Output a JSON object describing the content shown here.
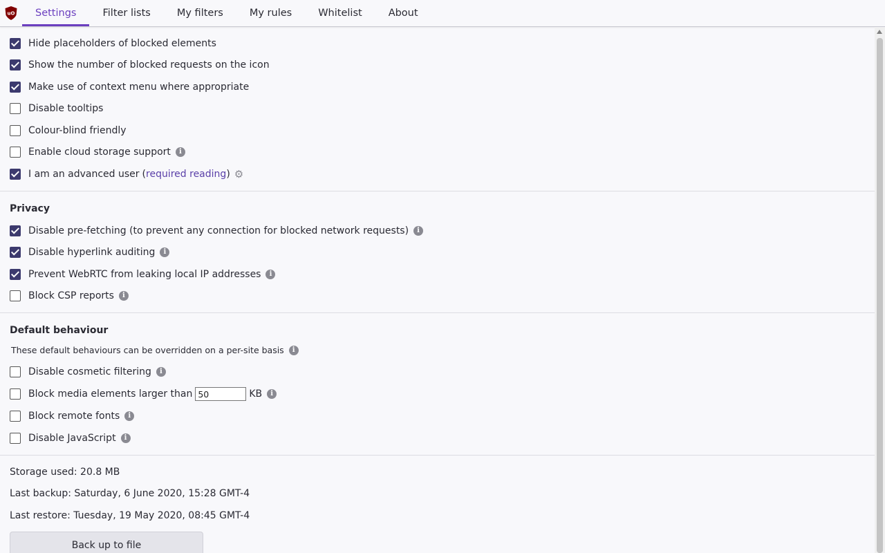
{
  "tabs": [
    "Settings",
    "Filter lists",
    "My filters",
    "My rules",
    "Whitelist",
    "About"
  ],
  "appearance": {
    "options": [
      {
        "label": "Hide placeholders of blocked elements",
        "checked": true
      },
      {
        "label": "Show the number of blocked requests on the icon",
        "checked": true
      },
      {
        "label": "Make use of context menu where appropriate",
        "checked": true
      },
      {
        "label": "Disable tooltips",
        "checked": false
      },
      {
        "label": "Colour-blind friendly",
        "checked": false
      },
      {
        "label": "Enable cloud storage support",
        "checked": false
      },
      {
        "label": "I am an advanced user",
        "checked": true
      }
    ],
    "advanced_paren_open": "(",
    "advanced_link": "required reading",
    "advanced_paren_close": ")"
  },
  "privacy": {
    "heading": "Privacy",
    "options": [
      {
        "label": "Disable pre-fetching (to prevent any connection for blocked network requests)",
        "checked": true
      },
      {
        "label": "Disable hyperlink auditing",
        "checked": true
      },
      {
        "label": "Prevent WebRTC from leaking local IP addresses",
        "checked": true
      },
      {
        "label": "Block CSP reports",
        "checked": false
      }
    ]
  },
  "default_behaviour": {
    "heading": "Default behaviour",
    "note": "These default behaviours can be overridden on a per-site basis",
    "options": [
      {
        "label": "Disable cosmetic filtering",
        "checked": false
      },
      {
        "label": "Block media elements larger than",
        "checked": false
      },
      {
        "label": "Block remote fonts",
        "checked": false
      },
      {
        "label": "Disable JavaScript",
        "checked": false
      }
    ],
    "media_size_value": "50",
    "media_size_unit": "KB"
  },
  "storage": {
    "used": "Storage used: 20.8 MB",
    "last_backup": "Last backup: Saturday, 6 June 2020, 15:28 GMT-4",
    "last_restore": "Last restore: Tuesday, 19 May 2020, 08:45 GMT-4",
    "backup_button": "Back up to file"
  },
  "colors": {
    "accent": "#6b3fbf",
    "checkbox": "#3c3a6e",
    "logo": "#800000"
  }
}
